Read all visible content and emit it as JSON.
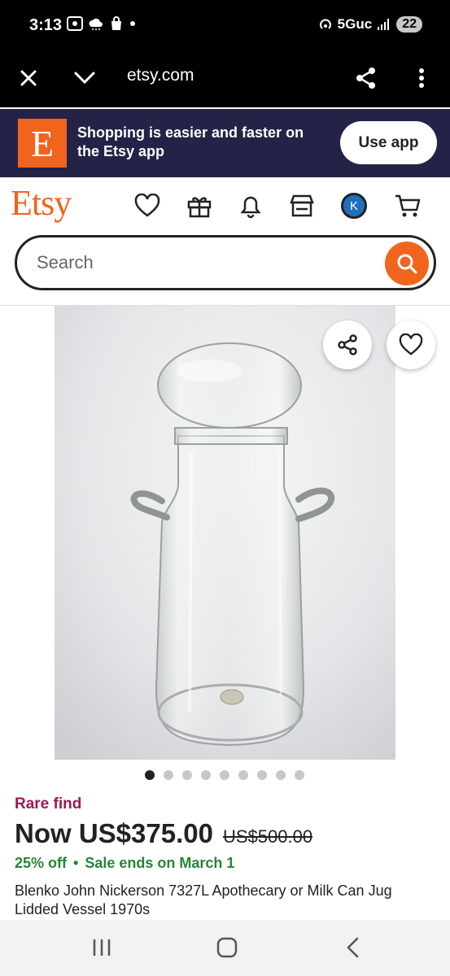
{
  "status_bar": {
    "time": "3:13",
    "network": "5Guc",
    "battery": "22"
  },
  "browser": {
    "url": "etsy.com"
  },
  "app_banner": {
    "logo_letter": "E",
    "text": "Shopping is easier and faster on the Etsy app",
    "button": "Use app"
  },
  "header": {
    "logo": "Etsy",
    "avatar_initial": "K"
  },
  "search": {
    "placeholder": "Search"
  },
  "carousel": {
    "total": 9,
    "active_index": 0
  },
  "listing": {
    "badge": "Rare find",
    "price_now": "Now US$375.00",
    "price_original": "US$500.00",
    "discount": "25% off",
    "separator": "•",
    "sale_end": "Sale ends on March 1",
    "title": "Blenko John Nickerson 7327L Apothecary or Milk Can Jug Lidded Vessel 1970s"
  },
  "colors": {
    "etsy_orange": "#f1641e",
    "banner_bg": "#232347",
    "rare_find": "#9b1c4c",
    "sale_green": "#258635"
  }
}
